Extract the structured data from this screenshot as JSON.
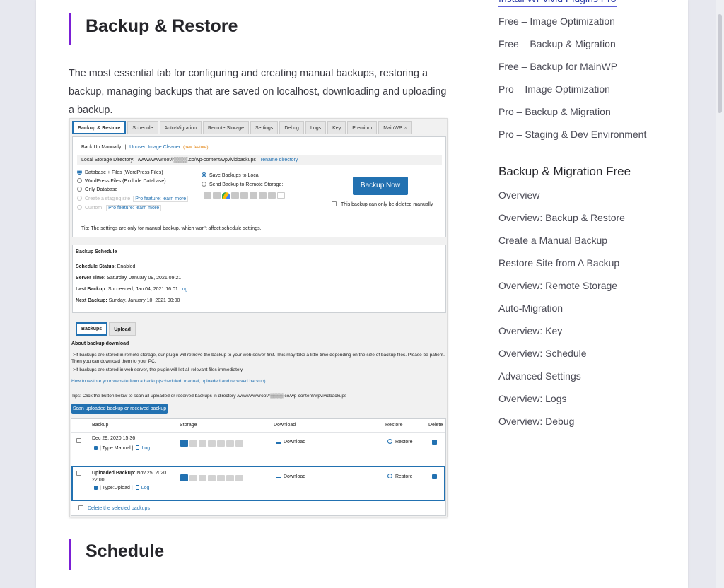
{
  "article": {
    "heading_top": "Backup & Restore",
    "intro": "The most essential tab for configuring and creating manual backups, restoring a backup, managing backups that are saved on localhost, downloading and uploading a backup.",
    "heading_bottom": "Schedule"
  },
  "sidebar": {
    "cut_link": "Install WPvivid Plugins Pro",
    "top_links": [
      "Free – Image Optimization",
      "Free – Backup & Migration",
      "Free – Backup for MainWP",
      "Pro – Image Optimization",
      "Pro – Backup & Migration",
      "Pro – Staging & Dev Environment"
    ],
    "section_title": "Backup & Migration Free",
    "section_links": [
      "Overview",
      "Overview: Backup & Restore",
      "Create a Manual Backup",
      "Restore Site from A Backup",
      "Overview: Remote Storage",
      "Auto-Migration",
      "Overview: Key",
      "Overview: Schedule",
      "Advanced Settings",
      "Overview: Logs",
      "Overview: Debug"
    ]
  },
  "shot": {
    "tabs": [
      "Backup & Restore",
      "Schedule",
      "Auto-Migration",
      "Remote Storage",
      "Settings",
      "Debug",
      "Logs",
      "Key",
      "Premium",
      "MainWP"
    ],
    "tab_close": "×",
    "backup_manually": "Back Up Manually",
    "sep": "|",
    "unused_cleaner": "Unused Image Cleaner",
    "new_feature": "(new feature)",
    "local_dir_label": "Local Storage Directory:",
    "local_dir_value": "/www/wwwroot/r▒▒▒▒.co/wp-content/wpvividbackups",
    "rename_directory": "rename directory",
    "options": [
      "Database + Files (WordPress Files)",
      "WordPress Files (Exclude Database)",
      "Only Database",
      "Create a staging site",
      "Custom"
    ],
    "pro_feature": "Pro feature: learn more",
    "save_local": "Save Backups to Local",
    "send_remote": "Send Backup to Remote Storage:",
    "backup_now": "Backup Now",
    "only_delete_manually": "This backup can only be deleted manually",
    "tip_label": "Tip:",
    "tip_text": "The settings are only for manual backup, which won't affect schedule settings.",
    "schedule_title": "Backup Schedule",
    "schedule_status_label": "Schedule Status:",
    "schedule_status": "Enabled",
    "server_time_label": "Server Time:",
    "server_time": "Saturday, January 09, 2021 09:21",
    "last_backup_label": "Last Backup:",
    "last_backup": "Succeeded, Jan 04, 2021 16:01",
    "log": "Log",
    "next_backup_label": "Next Backup:",
    "next_backup": "Sunday, January 10, 2021 00:00",
    "tabs2": [
      "Backups",
      "Upload"
    ],
    "about_title": "About backup download",
    "about_1": "->If backups are stored in remote storage, our plugin will retrieve the backup to your web server first. This may take a little time depending on the size of backup files. Please be patient. Then you can download them to your PC.",
    "about_2": "->If backups are stored in web server, the plugin will list all relevant files immediately.",
    "how_to": "How to restore your website from a backup(scheduled, manual, uploaded and received backup)",
    "tips_scan": "Tips: Click the button below to scan all uploaded or received backups in directory /www/wwwroot/r▒▒▒▒.co/wp-content/wpvividbackups",
    "scan_button": "Scan uploaded backup or received backup",
    "cols": [
      "Backup",
      "Storage",
      "Download",
      "Restore",
      "Delete"
    ],
    "rows": [
      {
        "date": "Dec 29, 2020 15:36",
        "type": "| Type:Manual |",
        "log": "Log",
        "download": "Download",
        "restore": "Restore"
      },
      {
        "prefix": "Uploaded Backup:",
        "date": "Nov 25, 2020 22:00",
        "type": "| Type:Upload |",
        "log": "Log",
        "download": "Download",
        "restore": "Restore"
      }
    ],
    "delete_selected": "Delete the selected backups"
  },
  "colors": {
    "accent_bar": "#7b1fd6",
    "wp_blue": "#2271b1",
    "link_underline": "#5b5fd8"
  }
}
